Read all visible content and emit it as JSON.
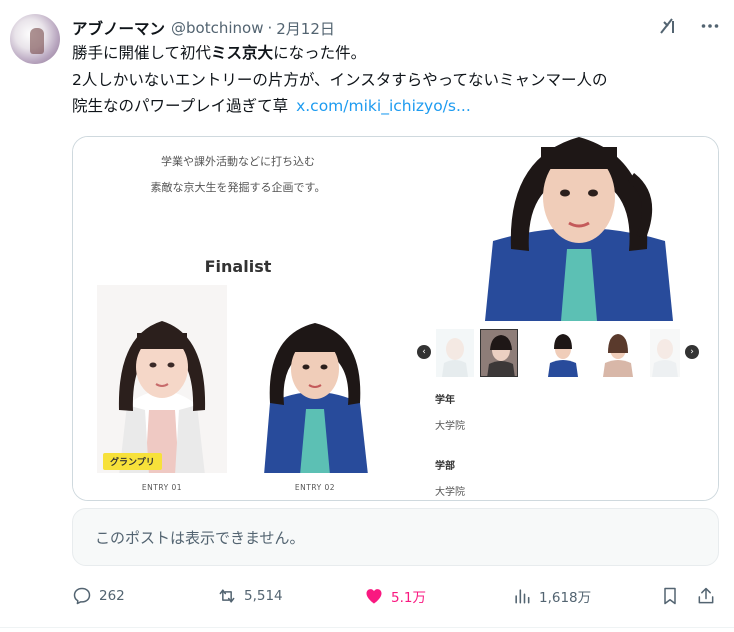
{
  "tweet": {
    "display_name": "アブノーマン",
    "handle": "@botchinow",
    "separator": "·",
    "date": "2月12日",
    "text_line1_a": "勝手に開催して初代",
    "text_line1_b": "ミス京大",
    "text_line1_c": "になった件。",
    "text_line2": "2人しかいないエントリーの片方が、インスタすらやってないミャンマー人の",
    "text_line3": "院生なのパワープレイ過ぎて草",
    "link": "x.com/miki_ichizyo/s..."
  },
  "media": {
    "promo_line1": "学業や課外活動などに打ち込む",
    "promo_line2": "素敵な京大生を発掘する企画です。",
    "finalist_title": "Finalist",
    "badge": "グランプリ",
    "entry1": "ENTRY 01",
    "entry2": "ENTRY 02",
    "nav_prev": "‹",
    "nav_next": "›",
    "info": [
      {
        "label": "学年",
        "value": "大学院"
      },
      {
        "label": "学部",
        "value": "大学院"
      }
    ]
  },
  "quote": {
    "text": "このポストは表示できません。"
  },
  "actions": {
    "replies": "262",
    "reposts": "5,514",
    "likes": "5.1万",
    "views": "1,618万"
  },
  "colors": {
    "link": "#1d9bf0",
    "like": "#f91880",
    "muted": "#536471",
    "badge": "#f7e13a"
  }
}
